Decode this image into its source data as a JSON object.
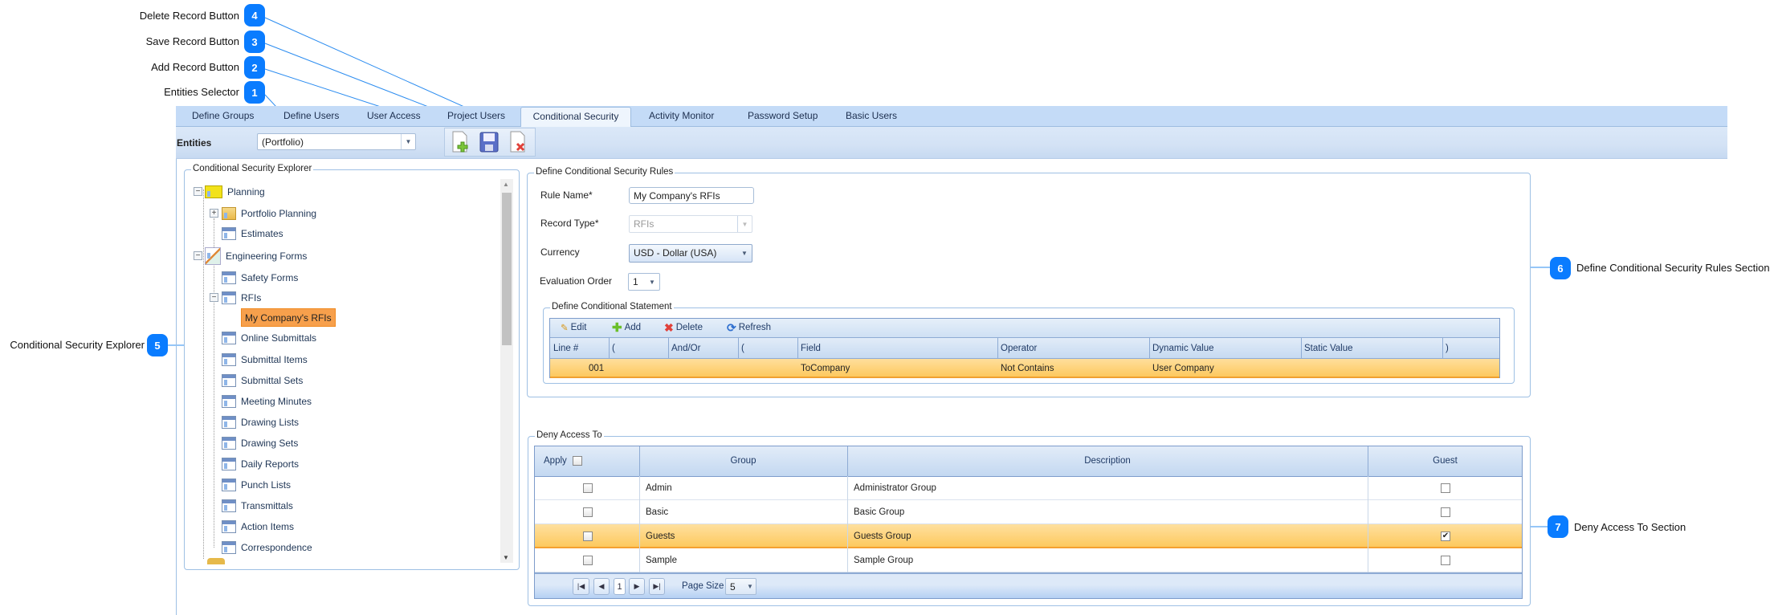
{
  "callouts": [
    {
      "number": "1",
      "label": "Entities Selector"
    },
    {
      "number": "2",
      "label": "Add Record Button"
    },
    {
      "number": "3",
      "label": "Save Record Button"
    },
    {
      "number": "4",
      "label": "Delete Record Button"
    },
    {
      "number": "5",
      "label": "Conditional Security Explorer"
    },
    {
      "number": "6",
      "label": "Define Conditional Security Rules Section"
    },
    {
      "number": "7",
      "label": "Deny Access To Section"
    }
  ],
  "tabs": [
    "Define Groups",
    "Define Users",
    "User Access",
    "Project Users",
    "Conditional Security",
    "Activity Monitor",
    "Password Setup",
    "Basic Users"
  ],
  "active_tab": "Conditional Security",
  "toolbar": {
    "entities_label": "Entities",
    "entities_value": "(Portfolio)",
    "buttons": [
      "add-record-icon",
      "save-record-icon",
      "delete-record-icon"
    ]
  },
  "explorer": {
    "title": "Conditional Security Explorer",
    "items": [
      {
        "label": "Planning",
        "icon": "planning-icon",
        "expander": "minus"
      },
      {
        "label": "Portfolio Planning",
        "icon": "folder-icon",
        "expander": "plus"
      },
      {
        "label": "Estimates",
        "icon": "form-icon"
      },
      {
        "label": "Engineering Forms",
        "icon": "engineering-icon",
        "expander": "minus"
      },
      {
        "label": "Safety Forms",
        "icon": "form-icon"
      },
      {
        "label": "RFIs",
        "icon": "form-icon",
        "expander": "minus"
      },
      {
        "label": "My Company's RFIs",
        "selected": true
      },
      {
        "label": "Online Submittals",
        "icon": "form-icon"
      },
      {
        "label": "Submittal Items",
        "icon": "form-icon"
      },
      {
        "label": "Submittal Sets",
        "icon": "form-icon"
      },
      {
        "label": "Meeting Minutes",
        "icon": "form-icon"
      },
      {
        "label": "Drawing Lists",
        "icon": "form-icon"
      },
      {
        "label": "Drawing Sets",
        "icon": "form-icon"
      },
      {
        "label": "Daily Reports",
        "icon": "form-icon"
      },
      {
        "label": "Punch Lists",
        "icon": "form-icon"
      },
      {
        "label": "Transmittals",
        "icon": "form-icon"
      },
      {
        "label": "Action Items",
        "icon": "form-icon"
      },
      {
        "label": "Correspondence",
        "icon": "form-icon"
      }
    ]
  },
  "rules": {
    "title": "Define Conditional Security Rules",
    "rule_name_label": "Rule Name*",
    "rule_name_value": "My Company's RFIs",
    "record_type_label": "Record Type*",
    "record_type_value": "RFIs",
    "currency_label": "Currency",
    "currency_value": "USD - Dollar (USA)",
    "evaluation_order_label": "Evaluation Order",
    "evaluation_order_value": "1",
    "statement": {
      "title": "Define Conditional Statement",
      "actions": [
        "Edit",
        "Add",
        "Delete",
        "Refresh"
      ],
      "columns": [
        "Line #",
        "(",
        "And/Or",
        "(",
        "Field",
        "Operator",
        "Dynamic Value",
        "Static Value",
        ")"
      ],
      "rows": [
        [
          "001",
          "",
          "",
          "",
          "ToCompany",
          "Not Contains",
          "User Company",
          "",
          ""
        ]
      ]
    }
  },
  "deny": {
    "title": "Deny Access To",
    "columns": [
      "Apply",
      "Group",
      "Description",
      "Guest"
    ],
    "rows": [
      {
        "group": "Admin",
        "description": "Administrator Group",
        "apply": false,
        "guest": false
      },
      {
        "group": "Basic",
        "description": "Basic Group",
        "apply": false,
        "guest": false
      },
      {
        "group": "Guests",
        "description": "Guests Group",
        "apply": false,
        "guest": true,
        "selected": true
      },
      {
        "group": "Sample",
        "description": "Sample Group",
        "apply": false,
        "guest": false
      }
    ],
    "pager": {
      "page": "1",
      "page_size_label": "Page Size",
      "page_size": "5"
    }
  },
  "colors": {
    "accent": "#0a7cff",
    "selection": "#fdd27a",
    "tree_selection": "#f7a04c",
    "tab_strip": "#c4dbf7"
  }
}
